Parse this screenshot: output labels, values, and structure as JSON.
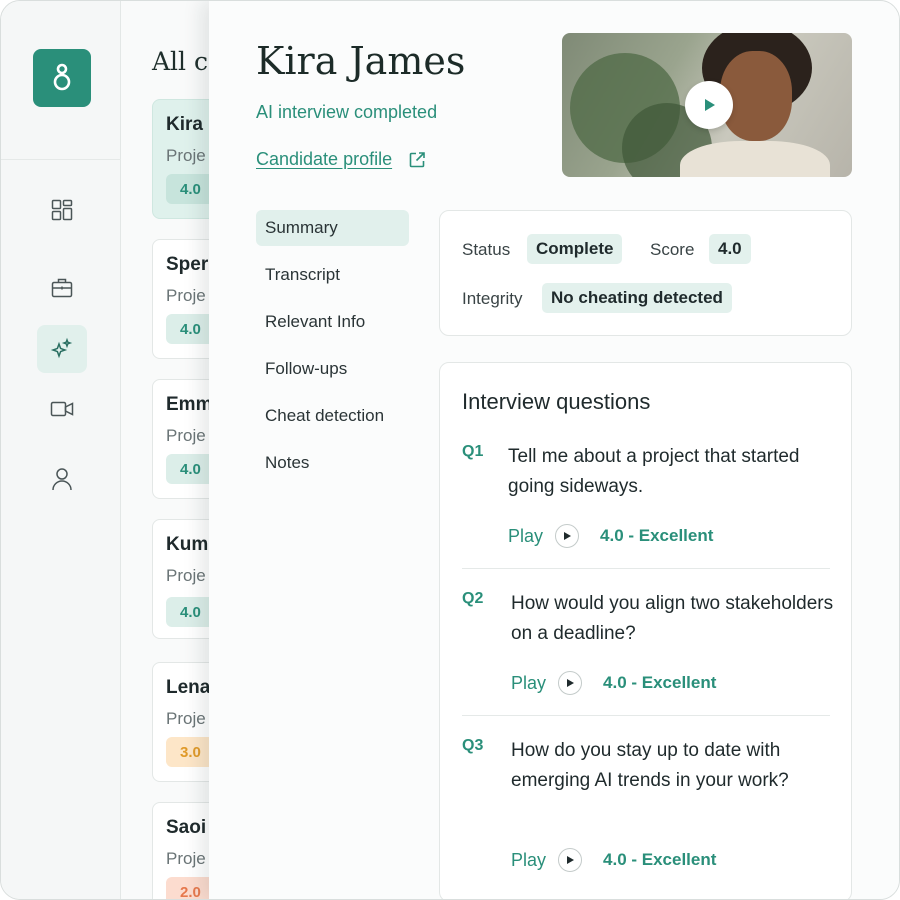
{
  "list": {
    "title": "All ca",
    "candidates": [
      {
        "name": "Kira",
        "project": "Proje",
        "score": "4.0"
      },
      {
        "name": "Sper",
        "project": "Proje",
        "score": "4.0"
      },
      {
        "name": "Emm",
        "project": "Proje",
        "score": "4.0"
      },
      {
        "name": "Kum",
        "project": "Proje",
        "score": "4.0"
      },
      {
        "name": "Lena",
        "project": "Proje",
        "score": "3.0"
      },
      {
        "name": "Saoi",
        "project": "Proje",
        "score": "2.0"
      }
    ]
  },
  "rail": {
    "icons": [
      "dashboard-icon",
      "briefcase-icon",
      "sparkles-icon",
      "video-icon",
      "user-icon"
    ],
    "active": "sparkles-icon"
  },
  "candidate": {
    "name": "Kira James",
    "status": "AI interview completed",
    "profile_link": "Candidate profile"
  },
  "subnav": {
    "items": [
      "Summary",
      "Transcript",
      "Relevant Info",
      "Follow-ups",
      "Cheat detection",
      "Notes"
    ],
    "active": "Summary"
  },
  "summary": {
    "status_label": "Status",
    "status_value": "Complete",
    "score_label": "Score",
    "score_value": "4.0",
    "integrity_label": "Integrity",
    "integrity_value": "No cheating detected"
  },
  "questions": {
    "title": "Interview questions",
    "items": [
      {
        "id": "Q1",
        "text": "Tell me about a project that started going sideways.",
        "play_label": "Play",
        "score": "4.0 - Excellent"
      },
      {
        "id": "Q2",
        "text": "How would you align two stakeholders on a deadline?",
        "play_label": "Play",
        "score": "4.0 - Excellent"
      },
      {
        "id": "Q3",
        "text": "How do you stay up to date with emerging AI trends in your work?",
        "play_label": "Play",
        "score": "4.0 - Excellent"
      }
    ]
  },
  "colors": {
    "brand": "#2a8f7a",
    "accent_bg": "#e1f0ec",
    "score_amber": "#e09a2a",
    "score_red": "#e6794e"
  }
}
